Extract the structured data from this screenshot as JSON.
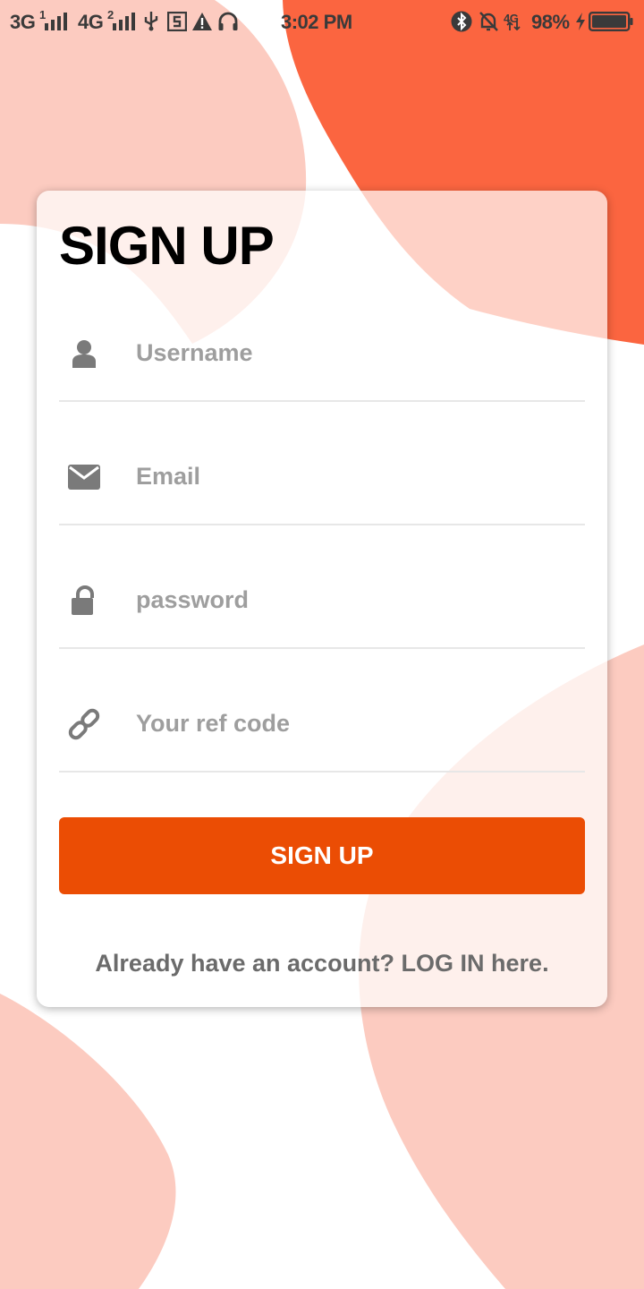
{
  "status_bar": {
    "network_1": "3G",
    "sim_1": "1",
    "network_2": "4G",
    "sim_2": "2",
    "time": "3:02 PM",
    "battery": "98%",
    "data_type": "4G"
  },
  "form": {
    "title": "SIGN UP",
    "fields": [
      {
        "placeholder": "Username",
        "icon": "user-icon",
        "value": ""
      },
      {
        "placeholder": "Email",
        "icon": "envelope-icon",
        "value": ""
      },
      {
        "placeholder": "password",
        "icon": "lock-icon",
        "value": ""
      },
      {
        "placeholder": "Your ref code",
        "icon": "link-icon",
        "value": ""
      }
    ],
    "submit_label": "SIGN UP",
    "login_prompt": "Already have an account? LOG IN here."
  },
  "colors": {
    "accent": "#eb4d04",
    "blob_dark": "#fb6540",
    "blob_light": "#fccbc0",
    "placeholder": "#9e9e9e",
    "icon": "#7a7a7a"
  }
}
